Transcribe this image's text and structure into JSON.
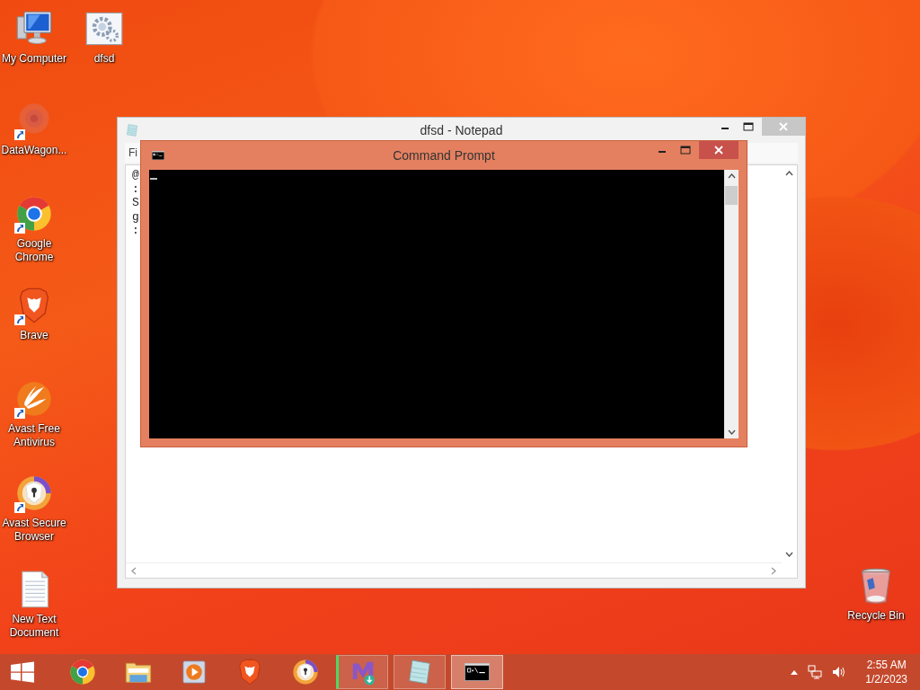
{
  "desktop_icons": [
    {
      "kind": "computer",
      "label": "My Computer",
      "shortcut": false
    },
    {
      "kind": "settings-file",
      "label": "dfsd",
      "shortcut": false
    },
    {
      "kind": "blur-logo",
      "label": "DataWagon...",
      "shortcut": true
    },
    {
      "kind": "browser",
      "label": "Google Chrome",
      "shortcut": true
    },
    {
      "kind": "lion",
      "label": "Brave",
      "shortcut": true
    },
    {
      "kind": "avast",
      "label": "Avast Free Antivirus",
      "shortcut": true
    },
    {
      "kind": "lock-browser",
      "label": "Avast Secure Browser",
      "shortcut": true
    },
    {
      "kind": "text-file",
      "label": "New Text Document",
      "shortcut": false
    },
    {
      "kind": "trash",
      "label": "Recycle Bin",
      "shortcut": false
    }
  ],
  "windows": [
    {
      "kind": "notepad",
      "title": "dfsd - Notepad",
      "active": false,
      "menu": [
        "Fi"
      ],
      "lines": [
        "@",
        ":",
        "S",
        "g",
        ":"
      ]
    },
    {
      "kind": "console",
      "title": "Command Prompt",
      "active": true
    }
  ],
  "taskbar": {
    "items": [
      {
        "kind": "browser",
        "running": false,
        "selected": false
      },
      {
        "kind": "folder",
        "running": false,
        "selected": false
      },
      {
        "kind": "player",
        "running": false,
        "selected": false
      },
      {
        "kind": "lion",
        "running": false,
        "selected": false
      },
      {
        "kind": "lock-browser",
        "running": false,
        "selected": false
      },
      {
        "kind": "installer",
        "running": true,
        "selected": false
      },
      {
        "kind": "notepad",
        "running": true,
        "selected": false
      },
      {
        "kind": "console",
        "running": true,
        "selected": true
      }
    ],
    "clock": {
      "time": "2:55 AM",
      "date": "1/2/2023"
    }
  }
}
